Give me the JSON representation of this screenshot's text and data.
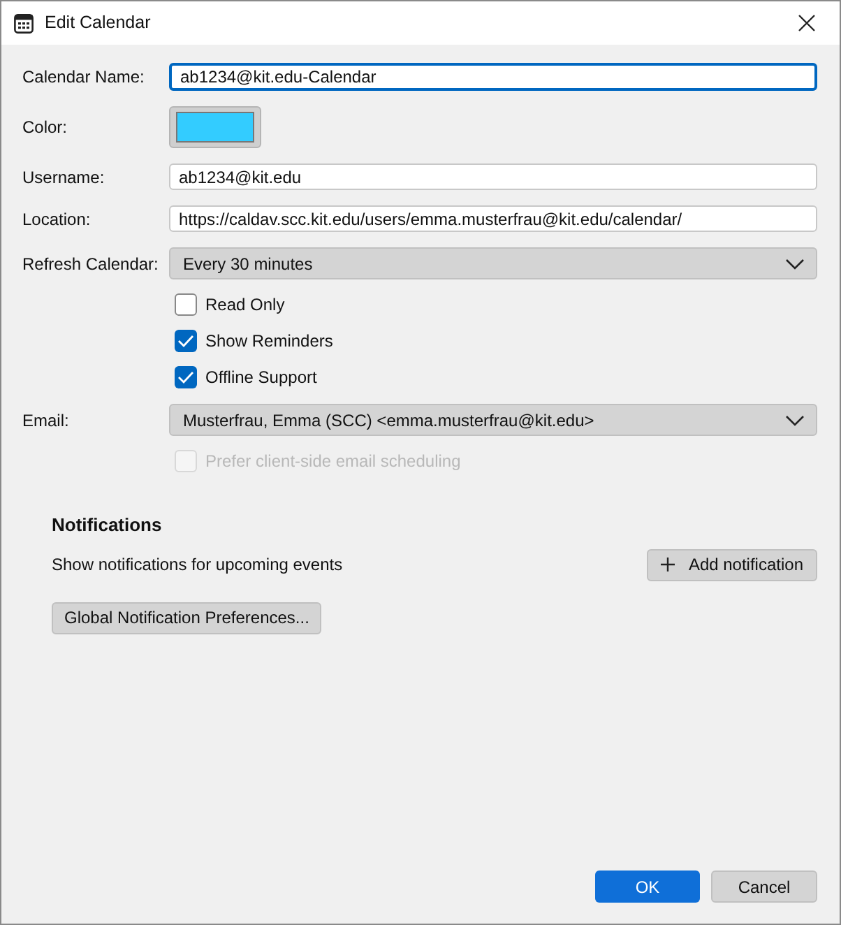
{
  "window": {
    "title": "Edit Calendar"
  },
  "form": [
    {
      "kind": "text",
      "label": "Calendar Name:",
      "value": "ab1234@kit.edu-Calendar",
      "focused": true
    },
    {
      "kind": "color",
      "label": "Color:",
      "color": "#33ccff"
    },
    {
      "kind": "text",
      "label": "Username:",
      "value": "ab1234@kit.edu",
      "focused": false
    },
    {
      "kind": "text",
      "label": "Location:",
      "value": "https://caldav.scc.kit.edu/users/emma.musterfrau@kit.edu/calendar/",
      "focused": false
    },
    {
      "kind": "select",
      "label": "Refresh Calendar:",
      "value": "Every 30 minutes"
    },
    {
      "kind": "checkbox",
      "label": "Read Only",
      "checked": false,
      "disabled": false
    },
    {
      "kind": "checkbox",
      "label": "Show Reminders",
      "checked": true,
      "disabled": false
    },
    {
      "kind": "checkbox",
      "label": "Offline Support",
      "checked": true,
      "disabled": false
    },
    {
      "kind": "select",
      "label": "Email:",
      "value": "Musterfrau, Emma (SCC) <emma.musterfrau@kit.edu>"
    },
    {
      "kind": "checkbox",
      "label": "Prefer client-side email scheduling",
      "checked": false,
      "disabled": true
    }
  ],
  "notifications": {
    "heading": "Notifications",
    "description": "Show notifications for upcoming events",
    "add_button": "Add notification",
    "global_button": "Global Notification Preferences..."
  },
  "buttons": [
    {
      "label": "OK",
      "primary": true
    },
    {
      "label": "Cancel",
      "primary": false
    }
  ]
}
